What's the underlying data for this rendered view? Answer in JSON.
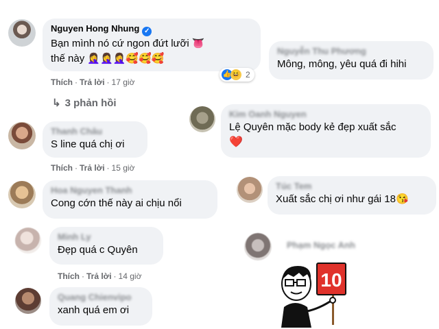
{
  "comments": [
    {
      "name": "Nguyen Hong Nhung",
      "verified": true,
      "text_line1": "Bạn mình nó cứ ngon đứt lưỡi 👅",
      "text_line2": "thế này 🤦‍♀️🤦‍♀️🤦‍♀️🥰🥰🥰",
      "like": "Thích",
      "reply": "Trả lời",
      "time": "17 giờ",
      "reaction_count": "2",
      "replies_label": "3 phản hồi"
    },
    {
      "name": "Thanh Châu",
      "text": "S line quá chị ơi",
      "like": "Thích",
      "reply": "Trả lời",
      "time": "15 giờ"
    },
    {
      "name": "Hoa Nguyen Thanh",
      "text": "Cong cớn thế này ai chịu nổi"
    },
    {
      "name": "Minh Ly",
      "text": "Đẹp quá c Quyên",
      "like": "Thích",
      "reply": "Trả lời",
      "time": "14 giờ"
    },
    {
      "name": "Quang Chienvipo",
      "text": "xanh quá em ơi"
    },
    {
      "name": "Nguyễn Thu Phương",
      "text": "Mông, mông, yêu quá đi hihi"
    },
    {
      "name": "Kim Oanh Nguyen",
      "text": "Lệ Quyên mặc body kẻ đẹp xuất sắc",
      "emoji": "❤️"
    },
    {
      "name": "Túc Tem",
      "text": "Xuất sắc chị ơi như gái 18😘"
    },
    {
      "name": "Phạm Ngọc Anh"
    }
  ],
  "sticker": {
    "sign_text": "10",
    "icon": "cartoon-man-holding-score-sign"
  },
  "colors": {
    "bubble": "#f0f2f5",
    "verified": "#1877f2",
    "meta_text": "#65676b"
  }
}
